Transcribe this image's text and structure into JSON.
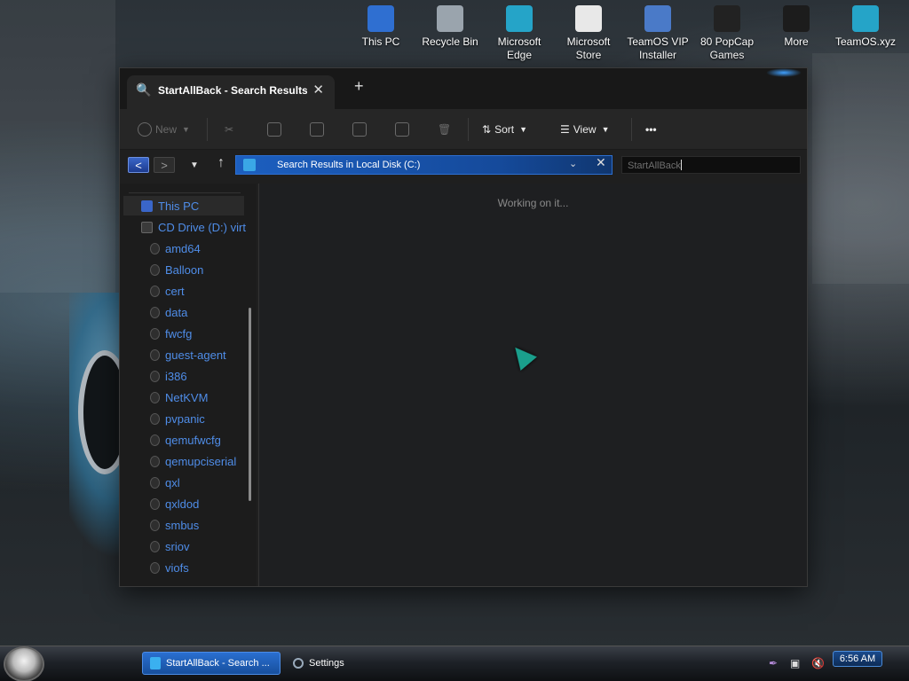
{
  "desktop": {
    "icons": [
      {
        "label_line1": "This PC",
        "label_line2": "",
        "icon": "monitor-icon",
        "color": "#2f6fd1"
      },
      {
        "label_line1": "Recycle Bin",
        "label_line2": "",
        "icon": "recycle-bin-icon",
        "color": "#9aa4ad"
      },
      {
        "label_line1": "Microsoft",
        "label_line2": "Edge",
        "icon": "edge-icon",
        "color": "#25a4c8"
      },
      {
        "label_line1": "Microsoft",
        "label_line2": "Store",
        "icon": "store-icon",
        "color": "#e8e8e8"
      },
      {
        "label_line1": "TeamOS VIP",
        "label_line2": "Installer",
        "icon": "installer-icon",
        "color": "#4a7ac8"
      },
      {
        "label_line1": "80 PopCap",
        "label_line2": "Games",
        "icon": "popcap-icon",
        "color": "#222"
      },
      {
        "label_line1": "More",
        "label_line2": "",
        "icon": "more-folder-icon",
        "color": "#1c1c1c"
      },
      {
        "label_line1": "TeamOS.xyz",
        "label_line2": "",
        "icon": "teamos-edge-icon",
        "color": "#25a4c8"
      }
    ]
  },
  "window": {
    "tab_title": "StartAllBack - Search Results i",
    "toolbar": {
      "new_label": "New",
      "sort_label": "Sort",
      "view_label": "View",
      "more_label": "•••"
    },
    "address": "Search Results in Local Disk (C:)",
    "search_value": "StartAllBack",
    "status_text": "Working on it...",
    "sidebar": {
      "root": "This PC",
      "drive": "CD Drive (D:) virt",
      "folders": [
        "amd64",
        "Balloon",
        "cert",
        "data",
        "fwcfg",
        "guest-agent",
        "i386",
        "NetKVM",
        "pvpanic",
        "qemufwcfg",
        "qemupciserial",
        "qxl",
        "qxldod",
        "smbus",
        "sriov",
        "viofs"
      ]
    }
  },
  "taskbar": {
    "items": [
      {
        "label": "StartAllBack - Search ...",
        "active": true
      },
      {
        "label": "Settings",
        "active": false
      }
    ],
    "clock": "6:56 AM"
  },
  "colors": {
    "accent": "#2f6fd1",
    "sidebar_text": "#4f8de8"
  }
}
